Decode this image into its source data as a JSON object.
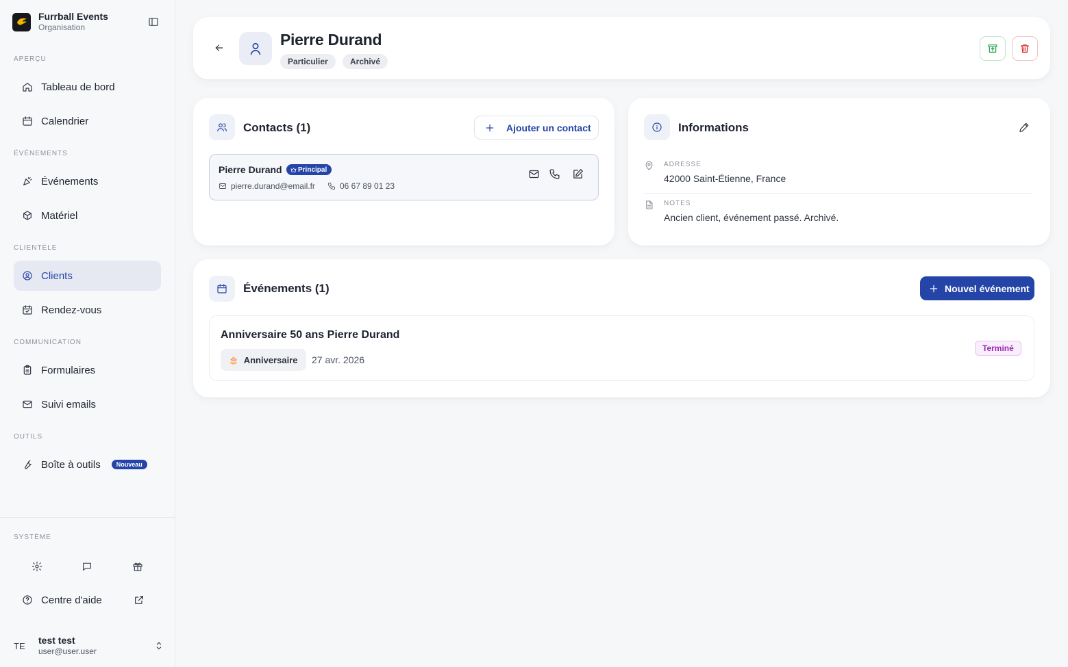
{
  "brand": {
    "name": "Furrball Events",
    "subtitle": "Organisation"
  },
  "sidebar": {
    "sections": {
      "overview": "APERÇU",
      "events": "ÉVÉNEMENTS",
      "clients": "CLIENTÈLE",
      "communication": "COMMUNICATION",
      "tools": "OUTILS",
      "system": "SYSTÈME"
    },
    "items": [
      {
        "label": "Tableau de bord",
        "icon": "home-icon"
      },
      {
        "label": "Calendrier",
        "icon": "calendar-icon"
      },
      {
        "label": "Événements",
        "icon": "party-icon"
      },
      {
        "label": "Matériel",
        "icon": "box-icon"
      },
      {
        "label": "Clients",
        "icon": "user-circle-icon",
        "active": true
      },
      {
        "label": "Rendez-vous",
        "icon": "calendar-check-icon"
      },
      {
        "label": "Formulaires",
        "icon": "clipboard-icon"
      },
      {
        "label": "Suivi emails",
        "icon": "mail-icon"
      },
      {
        "label": "Boîte à outils",
        "icon": "wrench-icon",
        "badge": "Nouveau"
      }
    ],
    "help": "Centre d'aide",
    "user": {
      "initials": "TE",
      "name": "test test",
      "email": "user@user.user"
    }
  },
  "client": {
    "name": "Pierre Durand",
    "tags": [
      "Particulier",
      "Archivé"
    ]
  },
  "contacts": {
    "title": "Contacts (1)",
    "add_label": "Ajouter un contact",
    "items": [
      {
        "name": "Pierre Durand",
        "badge": "Principal",
        "email": "pierre.durand@email.fr",
        "phone": "06 67 89 01 23"
      }
    ]
  },
  "info": {
    "title": "Informations",
    "address_label": "ADRESSE",
    "address": "42000 Saint-Étienne, France",
    "notes_label": "NOTES",
    "notes": "Ancien client, événement passé. Archivé."
  },
  "events": {
    "title": "Événements (1)",
    "new_label": "Nouvel événement",
    "items": [
      {
        "title": "Anniversaire 50 ans Pierre Durand",
        "type": "Anniversaire",
        "date": "27 avr. 2026",
        "status": "Terminé"
      }
    ]
  },
  "colors": {
    "accent": "#2444a8",
    "archive": "#1f9d4b",
    "delete": "#dc2626",
    "status_done": "#9c2bb4"
  }
}
